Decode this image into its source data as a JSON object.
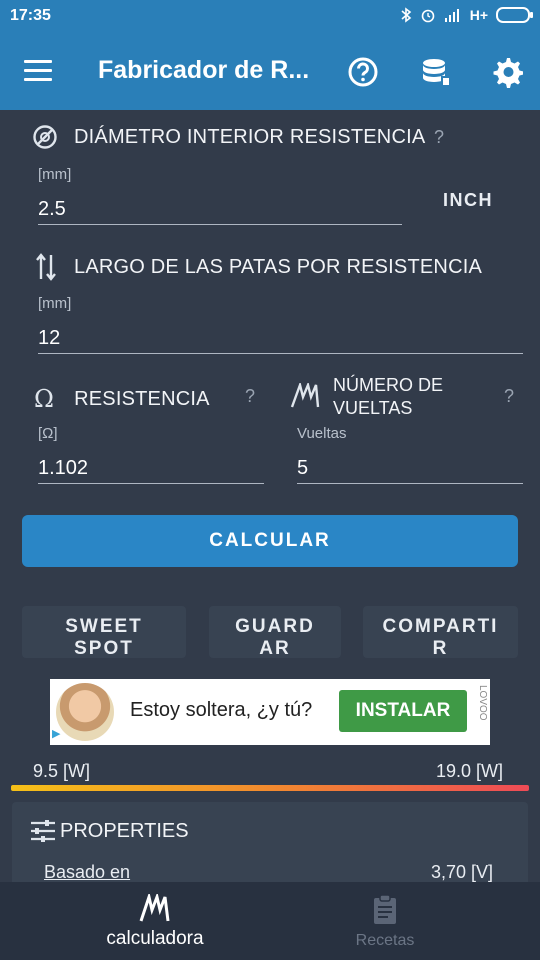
{
  "status_bar": {
    "time": "17:35",
    "network": "H+"
  },
  "app_bar": {
    "title": "Fabricador de R...",
    "icons": [
      "menu-icon",
      "help-icon",
      "database-icon",
      "settings-icon"
    ]
  },
  "fields": {
    "diameter": {
      "label": "DIÁMETRO INTERIOR RESISTENCIA",
      "help": "?",
      "unit": "[mm]",
      "value": "2.5",
      "toggle": "INCH"
    },
    "leg_length": {
      "label": "LARGO DE LAS PATAS POR RESISTENCIA",
      "unit": "[mm]",
      "value": "12"
    },
    "resistance": {
      "label": "RESISTENCIA",
      "help": "?",
      "unit": "[Ω]",
      "value": "1.102"
    },
    "wraps": {
      "label_line1": "NÚMERO DE",
      "label_line2": "VUELTAS",
      "help": "?",
      "unit": "Vueltas",
      "value": "5"
    }
  },
  "actions": {
    "calculate": "CALCULAR",
    "sweet_spot": "SWEET SPOT",
    "save": "GUARDAR",
    "share": "COMPARTIR"
  },
  "ad": {
    "text": "Estoy soltera, ¿y tú?",
    "button": "INSTALAR",
    "brand": "LOVOO"
  },
  "power_range": {
    "min": "9.5 [W]",
    "max": "19.0 [W]"
  },
  "properties": {
    "title": "PROPERTIES",
    "based_on_label": "Basado en",
    "based_on_value": "3,70 [V]"
  },
  "bottom_nav": {
    "calculator": "calculadora",
    "recipes": "Recetas"
  },
  "colors": {
    "accent": "#2a7fb8",
    "background": "#323b4a",
    "button": "#2a86c6",
    "install": "#3f9a46"
  }
}
